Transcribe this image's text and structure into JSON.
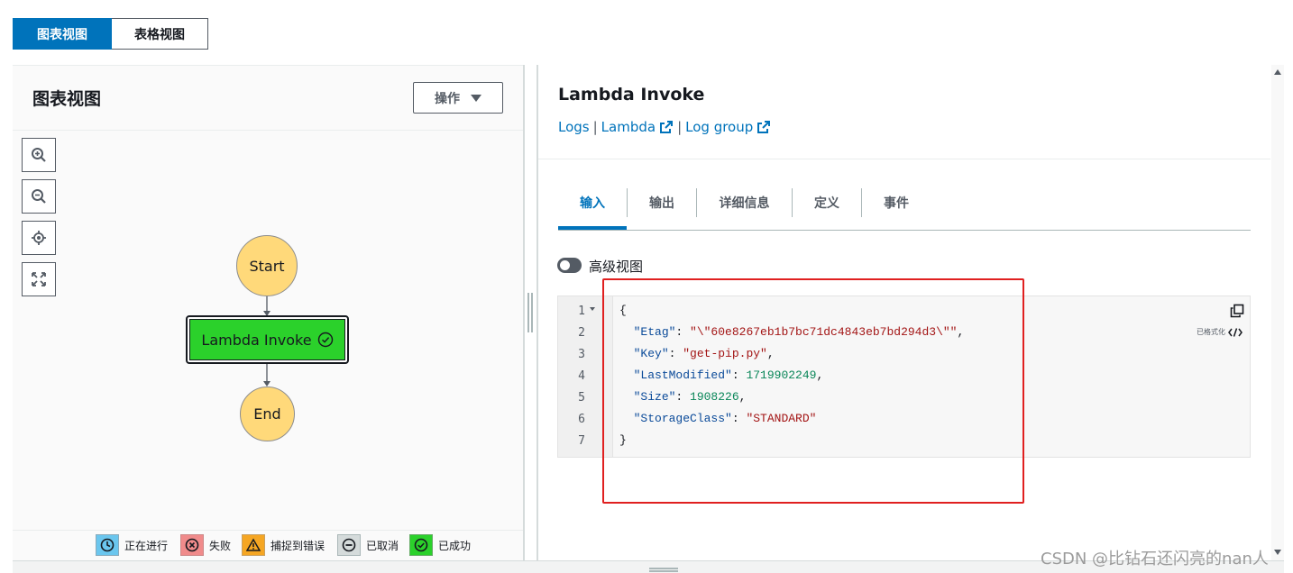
{
  "view_toggle": {
    "graph": "图表视图",
    "table": "表格视图"
  },
  "left_panel": {
    "title": "图表视图",
    "actions_label": "操作",
    "zoom_tools": [
      "zoom-in-icon",
      "zoom-out-icon",
      "center-icon",
      "fit-icon"
    ]
  },
  "graph": {
    "start": "Start",
    "task": "Lambda Invoke",
    "end": "End",
    "task_color": "#2bd12b",
    "terminal_color": "#ffd97a"
  },
  "legend": {
    "in_progress": "正在进行",
    "failed": "失败",
    "caught_error": "捕捉到错误",
    "cancelled": "已取消",
    "succeeded": "已成功"
  },
  "detail": {
    "title": "Lambda Invoke",
    "links": {
      "logs": "Logs",
      "sep": "|",
      "lambda": "Lambda",
      "log_group": "Log group"
    },
    "tabs": [
      "输入",
      "输出",
      "详细信息",
      "定义",
      "事件"
    ],
    "advanced_view_label": "高级视图",
    "format_label": "已格式化"
  },
  "code": {
    "line_numbers": [
      "1",
      "2",
      "3",
      "4",
      "5",
      "6",
      "7"
    ],
    "open": "{",
    "close": "}",
    "etag_key": "\"Etag\"",
    "etag_value": "\"\\\"60e8267eb1b7bc71dc4843eb7bd294d3\\\"\"",
    "key_key": "\"Key\"",
    "key_value": "\"get-pip.py\"",
    "lastmod_key": "\"LastModified\"",
    "lastmod_value": "1719902249",
    "size_key": "\"Size\"",
    "size_value": "1908226",
    "storage_key": "\"StorageClass\"",
    "storage_value": "\"STANDARD\"",
    "colon": ": ",
    "comma": ","
  },
  "watermark": "CSDN @比钻石还闪亮的nan人"
}
